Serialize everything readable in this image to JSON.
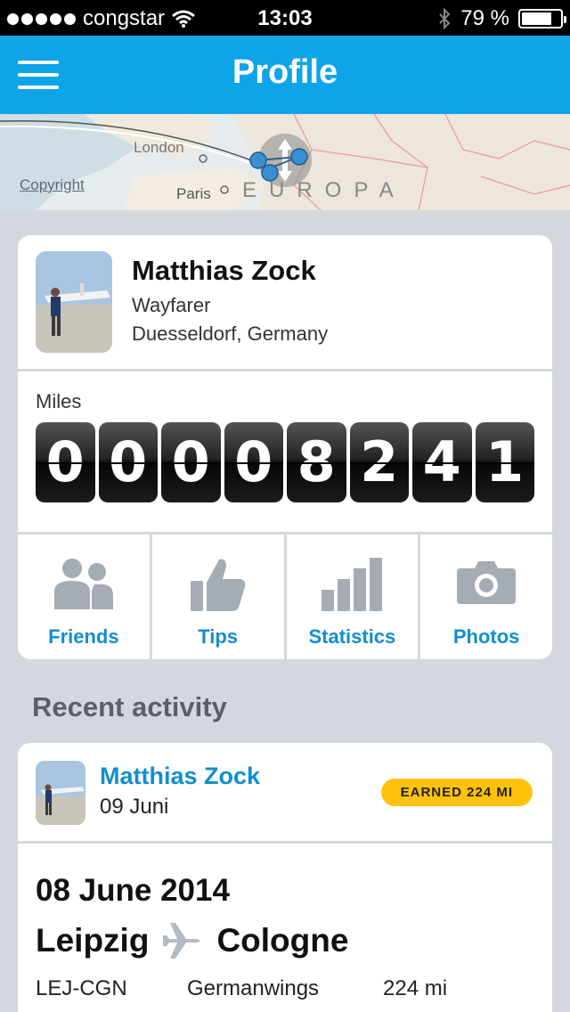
{
  "status_bar": {
    "carrier": "congstar",
    "time": "13:03",
    "battery": "79 %",
    "battery_level": 0.79,
    "signal_bars": 5
  },
  "nav": {
    "title": "Profile",
    "menu_icon": "hamburger-icon"
  },
  "map": {
    "copyright": "Copyright",
    "london": "London",
    "paris": "Paris",
    "region": "EUROPA"
  },
  "profile": {
    "name": "Matthias Zock",
    "rank": "Wayfarer",
    "location": "Duesseldorf, Germany",
    "miles_label": "Miles",
    "miles_digits": [
      "0",
      "0",
      "0",
      "0",
      "8",
      "2",
      "4",
      "1"
    ]
  },
  "actions": [
    {
      "label": "Friends",
      "icon": "friends-icon"
    },
    {
      "label": "Tips",
      "icon": "thumbs-up-icon"
    },
    {
      "label": "Statistics",
      "icon": "bar-chart-icon"
    },
    {
      "label": "Photos",
      "icon": "camera-icon"
    }
  ],
  "recent": {
    "title": "Recent activity",
    "items": [
      {
        "user": "Matthias Zock",
        "date": "09 Juni",
        "badge": "EARNED 224 MI",
        "flight_date": "08 June 2014",
        "origin": "Leipzig",
        "destination": "Cologne",
        "code": "LEJ-CGN",
        "airline": "Germanwings",
        "distance": "224 mi"
      }
    ]
  },
  "colors": {
    "primary": "#0ea4e8",
    "link": "#118ed0",
    "badge": "#ffc20a",
    "background": "#d4d8de"
  }
}
